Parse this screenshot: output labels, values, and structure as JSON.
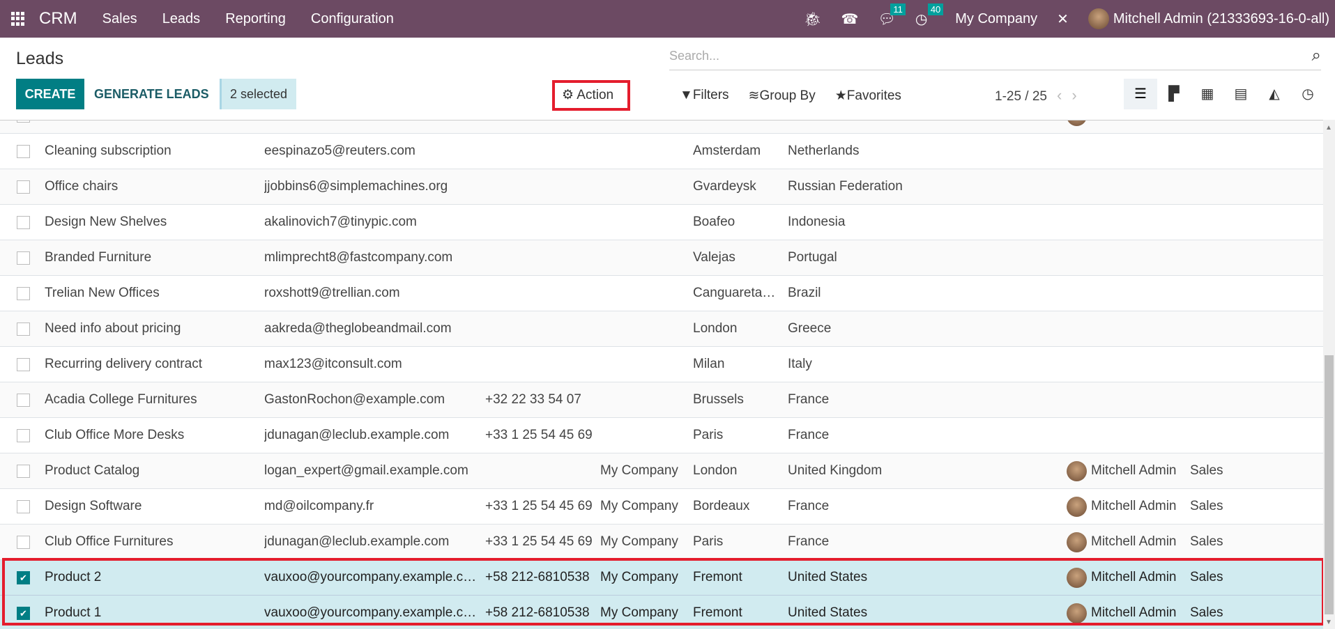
{
  "navbar": {
    "app": "CRM",
    "menus": [
      "Sales",
      "Leads",
      "Reporting",
      "Configuration"
    ],
    "messages_count": "11",
    "activities_count": "40",
    "company": "My Company",
    "user": "Mitchell Admin (21333693-16-0-all)"
  },
  "page": {
    "title": "Leads",
    "create": "CREATE",
    "generate": "GENERATE LEADS",
    "selected": "2 selected",
    "action": "Action"
  },
  "search": {
    "placeholder": "Search..."
  },
  "filters": {
    "filters": "Filters",
    "group_by": "Group By",
    "favorites": "Favorites"
  },
  "pager": {
    "range": "1-25 / 25"
  },
  "views": [
    "list",
    "kanban",
    "calendar",
    "pivot",
    "graph",
    "activity"
  ],
  "colors": {
    "navbar": "#6c4a63",
    "primary": "#017e84",
    "selected_row": "#d1ebf0",
    "highlight": "#e41d2d"
  },
  "rows": [
    {
      "name": "",
      "email": "",
      "phone": "",
      "company": "",
      "city": "",
      "country": "",
      "salesperson": "",
      "team": "",
      "selected": false,
      "avatar": true
    },
    {
      "name": "Cleaning subscription",
      "email": "eespinazo5@reuters.com",
      "phone": "",
      "company": "",
      "city": "Amsterdam",
      "country": "Netherlands",
      "salesperson": "",
      "team": "",
      "selected": false
    },
    {
      "name": "Office chairs",
      "email": "jjobbins6@simplemachines.org",
      "phone": "",
      "company": "",
      "city": "Gvardeysk",
      "country": "Russian Federation",
      "salesperson": "",
      "team": "",
      "selected": false
    },
    {
      "name": "Design New Shelves",
      "email": "akalinovich7@tinypic.com",
      "phone": "",
      "company": "",
      "city": "Boafeo",
      "country": "Indonesia",
      "salesperson": "",
      "team": "",
      "selected": false
    },
    {
      "name": "Branded Furniture",
      "email": "mlimprecht8@fastcompany.com",
      "phone": "",
      "company": "",
      "city": "Valejas",
      "country": "Portugal",
      "salesperson": "",
      "team": "",
      "selected": false
    },
    {
      "name": "Trelian New Offices",
      "email": "roxshott9@trellian.com",
      "phone": "",
      "company": "",
      "city": "Canguaretama",
      "country": "Brazil",
      "salesperson": "",
      "team": "",
      "selected": false
    },
    {
      "name": "Need info about pricing",
      "email": "aakreda@theglobeandmail.com",
      "phone": "",
      "company": "",
      "city": "London",
      "country": "Greece",
      "salesperson": "",
      "team": "",
      "selected": false
    },
    {
      "name": "Recurring delivery contract",
      "email": "max123@itconsult.com",
      "phone": "",
      "company": "",
      "city": "Milan",
      "country": "Italy",
      "salesperson": "",
      "team": "",
      "selected": false
    },
    {
      "name": "Acadia College Furnitures",
      "email": "GastonRochon@example.com",
      "phone": "+32 22 33 54 07",
      "company": "",
      "city": "Brussels",
      "country": "France",
      "salesperson": "",
      "team": "",
      "selected": false
    },
    {
      "name": "Club Office More Desks",
      "email": "jdunagan@leclub.example.com",
      "phone": "+33 1 25 54 45 69",
      "company": "",
      "city": "Paris",
      "country": "France",
      "salesperson": "",
      "team": "",
      "selected": false
    },
    {
      "name": "Product Catalog",
      "email": "logan_expert@gmail.example.com",
      "phone": "",
      "company": "My Company",
      "city": "London",
      "country": "United Kingdom",
      "salesperson": "Mitchell Admin",
      "team": "Sales",
      "selected": false
    },
    {
      "name": "Design Software",
      "email": "md@oilcompany.fr",
      "phone": "+33 1 25 54 45 69",
      "company": "My Company",
      "city": "Bordeaux",
      "country": "France",
      "salesperson": "Mitchell Admin",
      "team": "Sales",
      "selected": false
    },
    {
      "name": "Club Office Furnitures",
      "email": "jdunagan@leclub.example.com",
      "phone": "+33 1 25 54 45 69",
      "company": "My Company",
      "city": "Paris",
      "country": "France",
      "salesperson": "Mitchell Admin",
      "team": "Sales",
      "selected": false
    },
    {
      "name": "Product 2",
      "email": "vauxoo@yourcompany.example.com",
      "phone": "+58 212-6810538",
      "company": "My Company",
      "city": "Fremont",
      "country": "United States",
      "salesperson": "Mitchell Admin",
      "team": "Sales",
      "selected": true
    },
    {
      "name": "Product 1",
      "email": "vauxoo@yourcompany.example.com",
      "phone": "+58 212-6810538",
      "company": "My Company",
      "city": "Fremont",
      "country": "United States",
      "salesperson": "Mitchell Admin",
      "team": "Sales",
      "selected": true
    }
  ]
}
